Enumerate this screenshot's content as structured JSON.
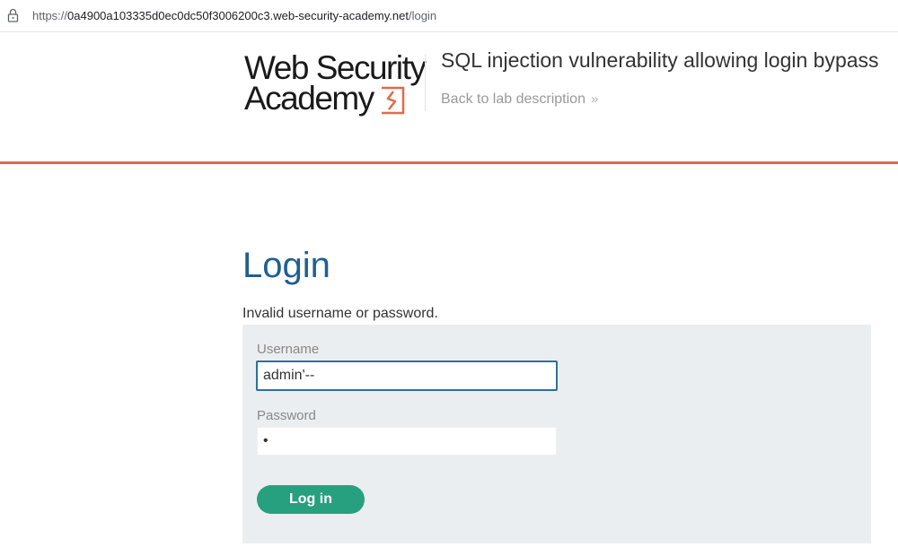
{
  "browser": {
    "url_prefix": "https://",
    "url_host": "0a4900a103335d0ec0dc50f3006200c3.web-security-academy.net",
    "url_path": "/login"
  },
  "header": {
    "logo_line1": "Web Security",
    "logo_line2": "Academy",
    "lab_title": "SQL injection vulnerability allowing login bypass",
    "back_link": "Back to lab description",
    "back_chevron": "»"
  },
  "login": {
    "heading": "Login",
    "error": "Invalid username or password.",
    "username_label": "Username",
    "username_value": "admin'--",
    "password_label": "Password",
    "password_value": "x",
    "submit_label": "Log in"
  },
  "colors": {
    "accent_orange": "#e06b4a",
    "heading_blue": "#1f5f93",
    "button_green": "#26a07e",
    "panel_bg": "#ebeef1"
  },
  "icons": [
    "lock-icon",
    "academy-logo-icon",
    "chevron-right-icon"
  ]
}
